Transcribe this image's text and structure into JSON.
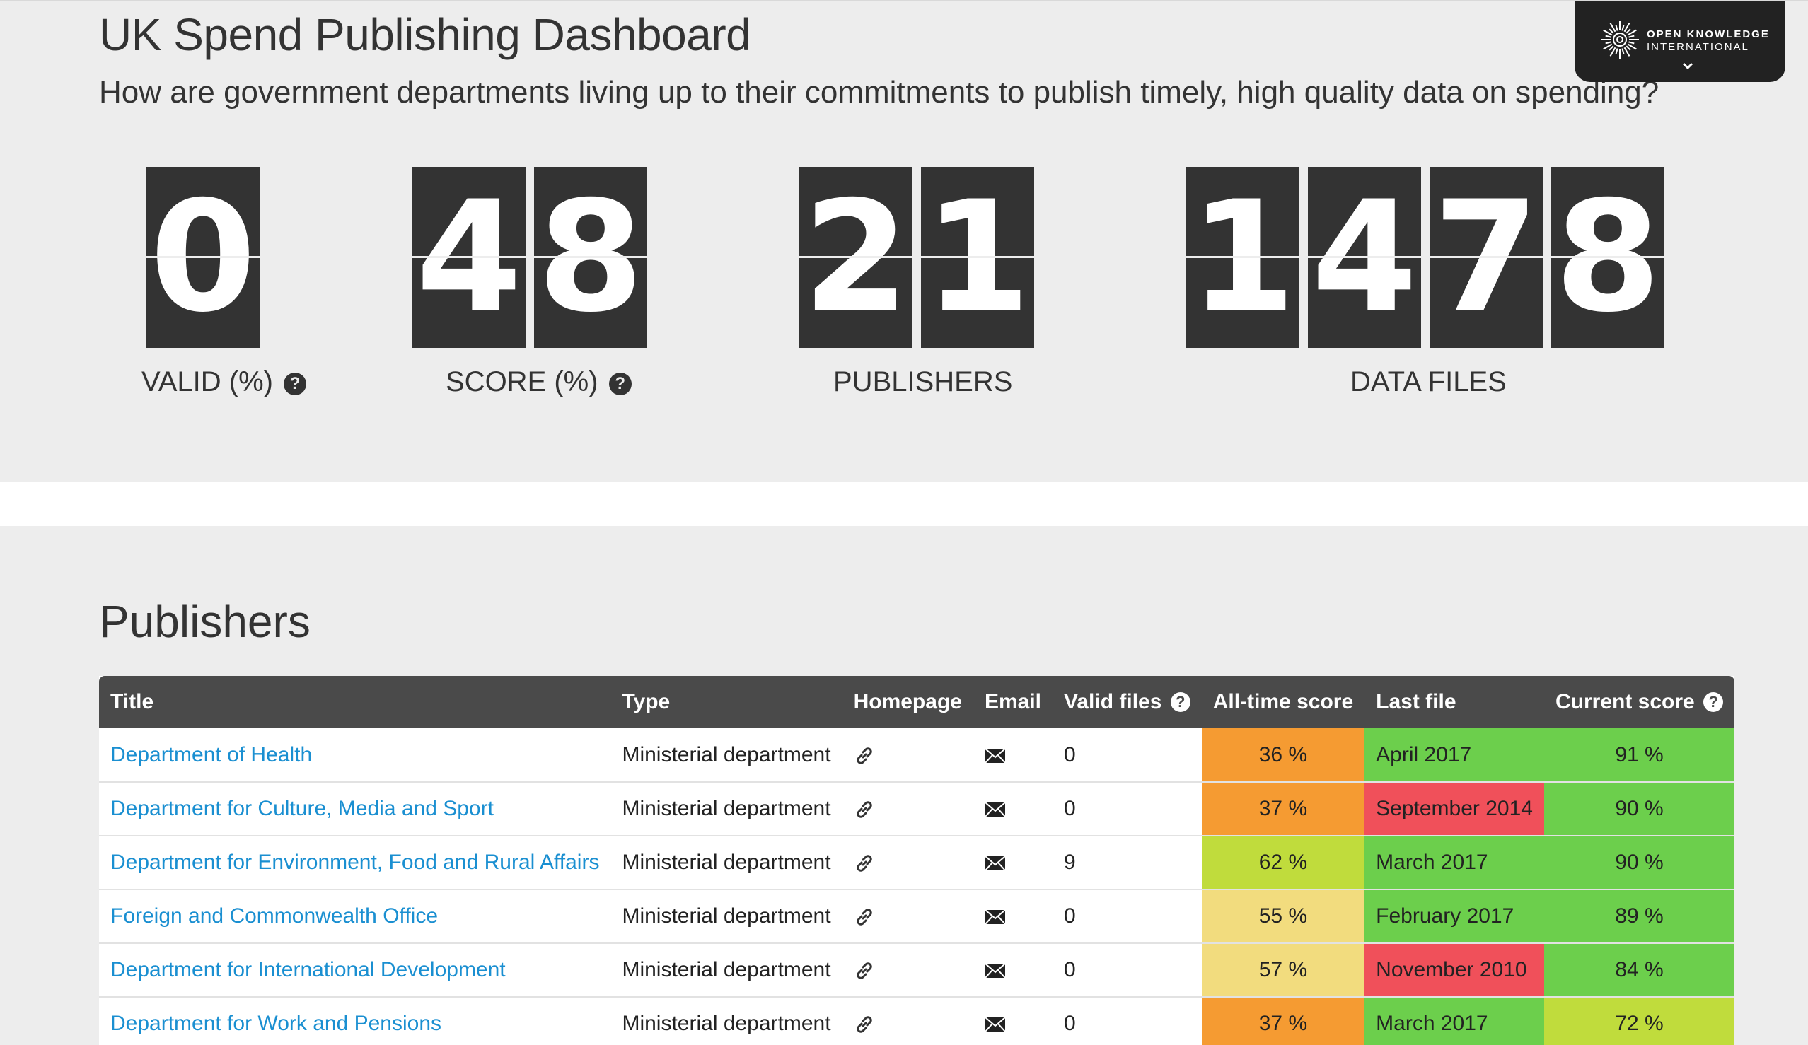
{
  "header": {
    "title": "UK Spend Publishing Dashboard",
    "subtitle": "How are government departments living up to their commitments to publish timely, high quality data on spending?"
  },
  "org_badge": {
    "line1": "OPEN KNOWLEDGE",
    "line2": "INTERNATIONAL",
    "logo_icon": "okfn-sunburst-icon",
    "toggle_icon": "chevron-down-icon"
  },
  "stats": [
    {
      "key": "valid",
      "digits": [
        "0"
      ],
      "label": "VALID (%)",
      "has_help": true
    },
    {
      "key": "score",
      "digits": [
        "4",
        "8"
      ],
      "label": "SCORE (%)",
      "has_help": true
    },
    {
      "key": "publishers",
      "digits": [
        "2",
        "1"
      ],
      "label": "PUBLISHERS",
      "has_help": false
    },
    {
      "key": "data_files",
      "digits": [
        "1",
        "4",
        "7",
        "8"
      ],
      "label": "DATA FILES",
      "has_help": false
    }
  ],
  "help_glyph": "?",
  "publishers": {
    "heading": "Publishers",
    "columns": {
      "title": "Title",
      "type": "Type",
      "homepage": "Homepage",
      "email": "Email",
      "valid_files": "Valid files",
      "all_time_score": "All-time score",
      "last_file": "Last file",
      "current_score": "Current score"
    },
    "rows": [
      {
        "title": "Department of Health",
        "type": "Ministerial department",
        "valid_files": "0",
        "all_time_score": "36 %",
        "last_file": "April 2017",
        "current_score": "91 %"
      },
      {
        "title": "Department for Culture, Media and Sport",
        "type": "Ministerial department",
        "valid_files": "0",
        "all_time_score": "37 %",
        "last_file": "September 2014",
        "current_score": "90 %"
      },
      {
        "title": "Department for Environment, Food and Rural Affairs",
        "type": "Ministerial department",
        "valid_files": "9",
        "all_time_score": "62 %",
        "last_file": "March 2017",
        "current_score": "90 %"
      },
      {
        "title": "Foreign and Commonwealth Office",
        "type": "Ministerial department",
        "valid_files": "0",
        "all_time_score": "55 %",
        "last_file": "February 2017",
        "current_score": "89 %"
      },
      {
        "title": "Department for International Development",
        "type": "Ministerial department",
        "valid_files": "0",
        "all_time_score": "57 %",
        "last_file": "November 2010",
        "current_score": "84 %"
      },
      {
        "title": "Department for Work and Pensions",
        "type": "Ministerial department",
        "valid_files": "0",
        "all_time_score": "37 %",
        "last_file": "March 2017",
        "current_score": "72 %"
      }
    ]
  },
  "colors": {
    "counter_bg": "#333333",
    "header_row": "#4a4a4a",
    "link": "#1a8fd1",
    "orange": "#f59b32",
    "yellow": "#f2dc7e",
    "lime": "#c0dc3c",
    "green": "#6ccf4c",
    "red": "#f0505a"
  }
}
